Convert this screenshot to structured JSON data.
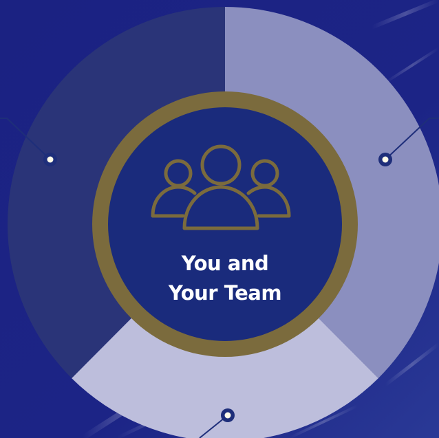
{
  "diagram": {
    "center_label": {
      "line1": "You and",
      "line2": "Your Team"
    },
    "center_icon": "team-group-icon",
    "segments": [
      {
        "id": "segment-left",
        "color": "#2a3478"
      },
      {
        "id": "segment-right",
        "color": "#8b8fbf"
      },
      {
        "id": "segment-bottom",
        "color": "#bdbedc"
      }
    ],
    "colors": {
      "background": "#1b2282",
      "hub_fill": "#1a2b7c",
      "hub_ring": "#7b6b3d",
      "icon_stroke": "#7b6b3d",
      "connector": "#1e2e7a",
      "marker_fill": "#fffbe8"
    }
  }
}
